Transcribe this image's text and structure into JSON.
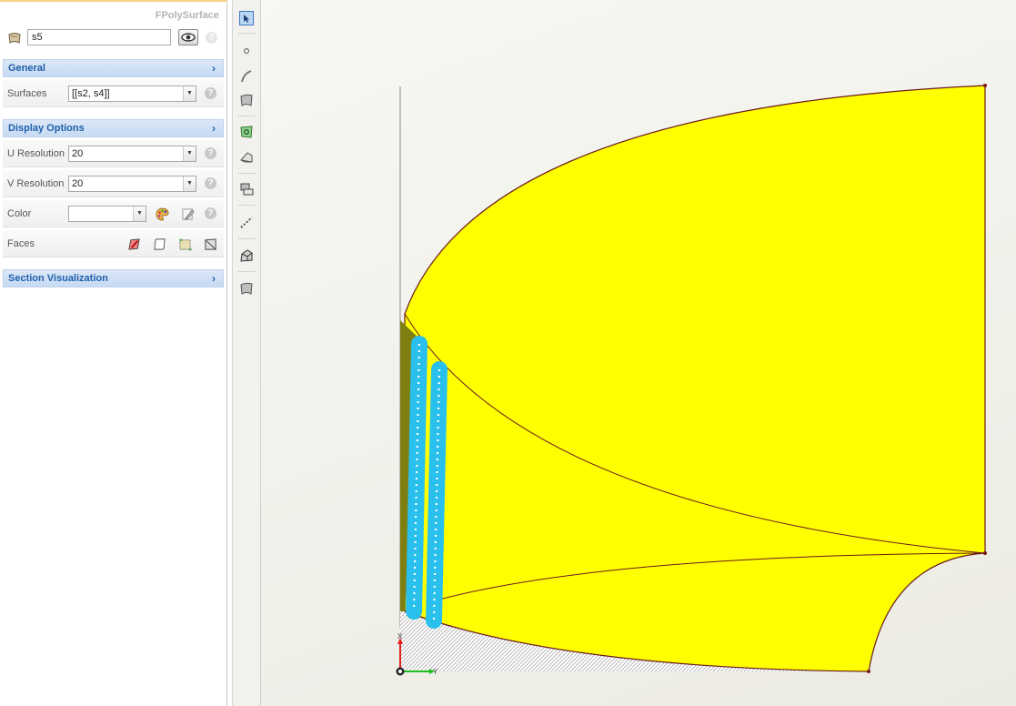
{
  "panel": {
    "object_type": "FPolySurface",
    "object_name": "s5",
    "sections": {
      "general": "General",
      "display_options": "Display Options",
      "section_visualization": "Section Visualization"
    },
    "properties": {
      "surfaces": {
        "label": "Surfaces",
        "value": "[[s2, s4]]"
      },
      "u_resolution": {
        "label": "U Resolution",
        "value": "20"
      },
      "v_resolution": {
        "label": "V Resolution",
        "value": "20"
      },
      "color": {
        "label": "Color",
        "value": ""
      },
      "faces": {
        "label": "Faces"
      }
    },
    "help_glyph": "?"
  },
  "toolbar": {
    "icons": [
      "select-arrow-icon",
      "point-icon",
      "curve-icon",
      "surface-icon",
      "surface-from-points-icon",
      "extrude-surface-icon",
      "polysurface-icon",
      "dashed-line-icon",
      "shaded-solid-icon",
      "patch-surface-icon"
    ]
  },
  "viewport": {
    "axis_labels": {
      "x": "X",
      "y": "Y"
    },
    "colors": {
      "surface_fill": "#ffff00",
      "edge": "#6b1a1a",
      "section_line": "#29c0ee",
      "axis_x": "#e02020",
      "axis_y": "#1fbf1f"
    }
  }
}
